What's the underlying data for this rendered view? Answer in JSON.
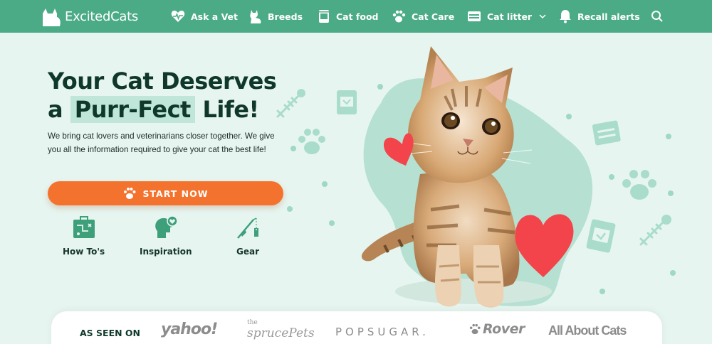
{
  "brand": {
    "name": "ExcitedCats"
  },
  "nav": {
    "items": [
      {
        "label": "Ask a Vet",
        "icon": "heart-pulse-icon"
      },
      {
        "label": "Breeds",
        "icon": "cat-sitting-icon"
      },
      {
        "label": "Cat food",
        "icon": "food-bag-icon"
      },
      {
        "label": "Cat Care",
        "icon": "paw-icon"
      },
      {
        "label": "Cat litter",
        "icon": "litter-box-icon",
        "dropdown": true
      },
      {
        "label": "Recall alerts",
        "icon": "bell-icon"
      }
    ],
    "search_icon": "search-icon"
  },
  "hero": {
    "title_line1": "Your Cat Deserves",
    "title_line2_pre": "a",
    "title_highlight": "Purr-Fect",
    "title_line2_post": "Life!",
    "description": "We bring cat lovers and veterinarians closer together. We give you all the information required to give your cat the best life!",
    "cta_label": "START NOW",
    "cta_icon": "paw-icon"
  },
  "categories": [
    {
      "label": "How To's",
      "icon": "blueprint-icon"
    },
    {
      "label": "Inspiration",
      "icon": "head-heart-icon"
    },
    {
      "label": "Gear",
      "icon": "cat-toy-wand-icon"
    }
  ],
  "as_seen_on": {
    "label": "AS SEEN ON",
    "brands": [
      "yahoo!",
      "the",
      "sprucePets",
      "POPSUGAR.",
      "Rover",
      "All About Cats"
    ]
  },
  "colors": {
    "nav_bg": "#4aab86",
    "page_bg": "#e6f5f0",
    "accent": "#f3732e",
    "heart": "#f2444a",
    "dark_text": "#10382a"
  }
}
